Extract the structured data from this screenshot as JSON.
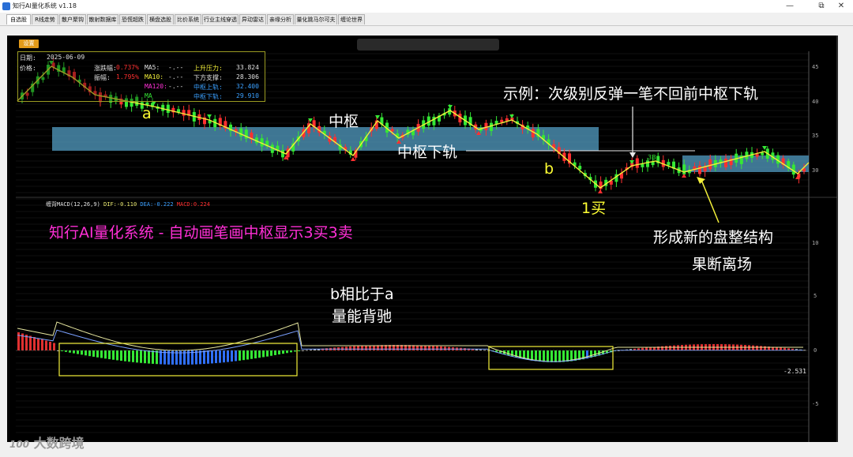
{
  "window": {
    "title": "知行AI量化系统 v1.18",
    "minimize_glyph": "—",
    "maximize_glyph": "⧉",
    "close_glyph": "✕"
  },
  "tabs": [
    {
      "label": "自选股",
      "active": true
    },
    {
      "label": "R线走势",
      "active": false
    },
    {
      "label": "散户聚钩",
      "active": false
    },
    {
      "label": "散射数据库",
      "active": false
    },
    {
      "label": "恐慌超跌",
      "active": false
    },
    {
      "label": "横盘选股",
      "active": false
    },
    {
      "label": "比价系统",
      "active": false
    },
    {
      "label": "行业主线穿透",
      "active": false
    },
    {
      "label": "异动雷达",
      "active": false
    },
    {
      "label": "亲缘分析",
      "active": false
    },
    {
      "label": "量化跳马尔可夫",
      "active": false
    },
    {
      "label": "缠论世界",
      "active": false
    }
  ],
  "toolbar": {
    "settings_label": "设置"
  },
  "info_panel": {
    "date_label": "日期:",
    "date_value": "2025-06-09",
    "price_label": "价格:",
    "change_label": "涨跌幅:",
    "change_value": "0.737%",
    "amplitude_label": "振幅:",
    "amplitude_value": "1.795%",
    "ma5_label": "MA5:",
    "ma5_value": "-.--",
    "ma10_label": "MA10:",
    "ma10_value": "-.--",
    "ma120_label": "MA120:",
    "ma120_value": "-.--",
    "ma_more_label": "MA",
    "resistance_label": "上升压力:",
    "resistance_value": "33.824",
    "support_label": "下方支撑:",
    "support_value": "28.306",
    "center_upper_label": "中枢上轨:",
    "center_upper_value": "32.400",
    "center_lower_label": "中枢下轨:",
    "center_lower_value": "29.910"
  },
  "price_axis": {
    "ticks": [
      "45",
      "40",
      "35",
      "30"
    ]
  },
  "macd_axis": {
    "ticks": [
      "10",
      "5",
      "0",
      "-5"
    ],
    "current_value": "-2.531"
  },
  "macd_header": {
    "name": "缠背MACD(12,26,9)",
    "dif": "DIF:-0.110",
    "dea": "DEA:-0.222",
    "macd": "MACD:0.224"
  },
  "annotations": {
    "example": "示例：次级别反弹一笔不回前中枢下轨",
    "center": "中枢",
    "center_lower": "中枢下轨",
    "a": "a",
    "b": "b",
    "buy1": "1买",
    "promo": "知行AI量化系统 - 自动画笔画中枢显示3买3卖",
    "new_consolidation": "形成新的盘整结构",
    "exit": "果断离场",
    "divergence_1": "b相比于a",
    "divergence_2": "量能背驰",
    "label_3b": "3B"
  },
  "watermark": {
    "text": "大数跨境",
    "logo_text": "100"
  },
  "colors": {
    "up": "#ff3030",
    "down": "#35e835",
    "accent_yellow": "#f2ef3a",
    "promo_magenta": "#ff2fd6",
    "center_box": "#4e93b8",
    "grid": "#2a2a2a",
    "macd_neg": "#35e835",
    "macd_pos": "#e03030",
    "macd_blue": "#3070ff"
  }
}
